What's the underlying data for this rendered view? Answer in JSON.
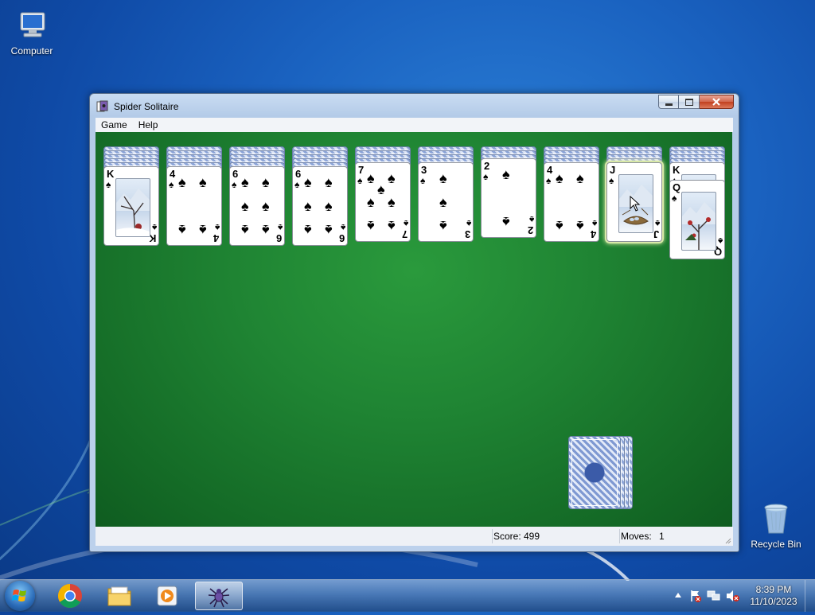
{
  "desktop": {
    "icons": [
      {
        "label": "Computer"
      },
      {
        "label": "Recycle Bin"
      }
    ]
  },
  "window": {
    "title": "Spider Solitaire",
    "menu": [
      "Game",
      "Help"
    ]
  },
  "game": {
    "columns": [
      {
        "facedown": 5,
        "card": {
          "rank": "K",
          "type": "face"
        }
      },
      {
        "facedown": 5,
        "card": {
          "rank": "4",
          "type": "pips"
        }
      },
      {
        "facedown": 5,
        "card": {
          "rank": "6",
          "type": "pips"
        }
      },
      {
        "facedown": 5,
        "card": {
          "rank": "6",
          "type": "pips"
        }
      },
      {
        "facedown": 4,
        "card": {
          "rank": "7",
          "type": "pips"
        }
      },
      {
        "facedown": 4,
        "card": {
          "rank": "3",
          "type": "pips"
        }
      },
      {
        "facedown": 3,
        "card": {
          "rank": "2",
          "type": "pips"
        }
      },
      {
        "facedown": 4,
        "card": {
          "rank": "4",
          "type": "pips"
        }
      },
      {
        "facedown": 4,
        "card": {
          "rank": "J",
          "type": "face",
          "selected": true
        }
      },
      {
        "facedown": 4,
        "card": {
          "rank": "K",
          "type": "face"
        },
        "extra": {
          "rank": "Q",
          "type": "face"
        }
      }
    ],
    "suit_symbol": "♠",
    "stock_piles": 4
  },
  "status": {
    "score_label": "Score:",
    "score_value": "499",
    "moves_label": "Moves:",
    "moves_value": "1"
  },
  "taskbar": {
    "time": "8:39 PM",
    "date": "11/10/2023"
  },
  "colors": {
    "felt": "#1f8433",
    "desktop": "#1a62c0"
  }
}
